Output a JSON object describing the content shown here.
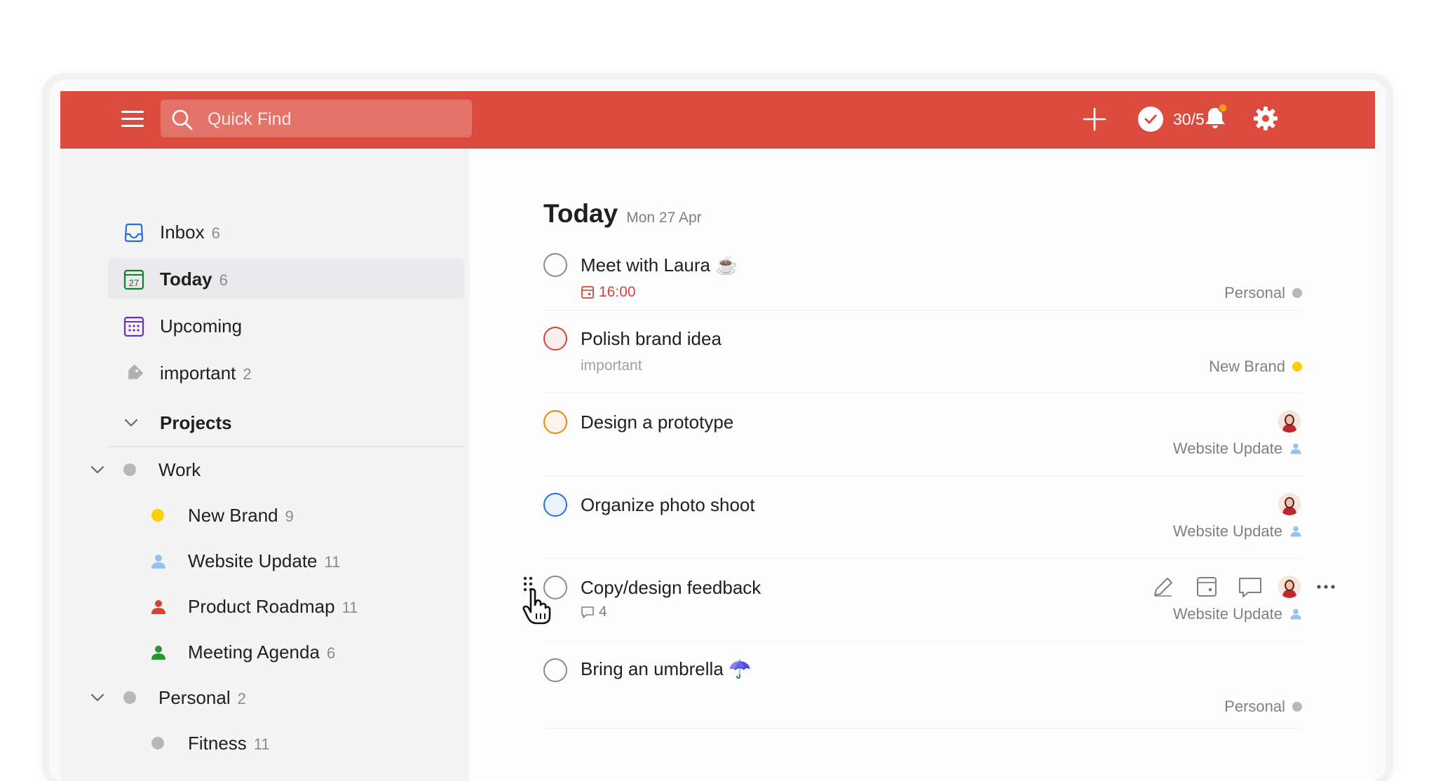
{
  "topbar": {
    "search_placeholder": "Quick Find",
    "karma": "30/5",
    "accent": "#db4c3f"
  },
  "sidebar": {
    "nav": [
      {
        "label": "Inbox",
        "count": "6",
        "icon": "inbox-icon"
      },
      {
        "label": "Today",
        "count": "6",
        "icon": "calendar-today-icon",
        "day": "27"
      },
      {
        "label": "Upcoming",
        "count": "",
        "icon": "calendar-upcoming-icon"
      },
      {
        "label": "important",
        "count": "2",
        "icon": "label-icon"
      }
    ],
    "projects_header": "Projects",
    "projects": [
      {
        "label": "Work",
        "count": "",
        "color": "#b8b8b8"
      },
      {
        "label": "New Brand",
        "count": "9",
        "color": "#fad000"
      },
      {
        "label": "Website Update",
        "count": "11",
        "color": "#96c3eb"
      },
      {
        "label": "Product Roadmap",
        "count": "11",
        "color": "#db4035"
      },
      {
        "label": "Meeting Agenda",
        "count": "6",
        "color": "#299438"
      },
      {
        "label": "Personal",
        "count": "2",
        "color": "#b8b8b8"
      },
      {
        "label": "Fitness",
        "count": "11",
        "color": "#b8b8b8"
      }
    ]
  },
  "main": {
    "title": "Today",
    "date": "Mon 27 Apr",
    "tasks": [
      {
        "title": "Meet with Laura ☕",
        "sub": "16:00",
        "project": "Personal",
        "priority_color": "#8a8a8a"
      },
      {
        "title": "Polish brand idea",
        "sub": "important",
        "project": "New Brand",
        "priority_color": "#d1453b"
      },
      {
        "title": "Design a prototype",
        "sub": "",
        "project": "Website Update",
        "priority_color": "#eb8909"
      },
      {
        "title": "Organize photo shoot",
        "sub": "",
        "project": "Website Update",
        "priority_color": "#246fe0"
      },
      {
        "title": "Copy/design feedback",
        "sub": "4",
        "project": "Website Update",
        "priority_color": "#8a8a8a"
      },
      {
        "title": "Bring an umbrella ☂️",
        "sub": "",
        "project": "Personal",
        "priority_color": "#8a8a8a"
      }
    ]
  }
}
